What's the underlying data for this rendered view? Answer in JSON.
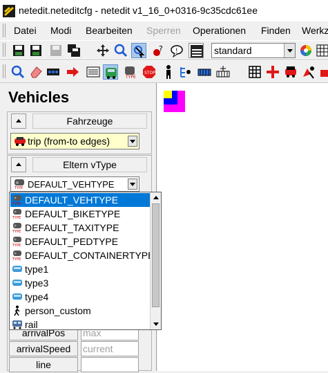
{
  "window": {
    "title": "netedit.neteditcfg - netedit v1_16_0+0316-9c35cdc61ee"
  },
  "menu": {
    "items": [
      {
        "label": "Datei",
        "disabled": false
      },
      {
        "label": "Modi",
        "disabled": false
      },
      {
        "label": "Bearbeiten",
        "disabled": false
      },
      {
        "label": "Sperren",
        "disabled": true
      },
      {
        "label": "Operationen",
        "disabled": false
      },
      {
        "label": "Finden",
        "disabled": false
      },
      {
        "label": "Werkz",
        "disabled": false
      }
    ]
  },
  "toolbar": {
    "mode_select_value": "standard"
  },
  "frame": {
    "title": "Vehicles",
    "vehicles_group": {
      "label": "Fahrzeuge",
      "selected_type": "trip (from-to edges)"
    },
    "parent_vtype_group": {
      "label": "Eltern vType",
      "selected_vtype": "DEFAULT_VEHTYPE"
    },
    "vtype_options": [
      {
        "label": "DEFAULT_VEHTYPE",
        "icon": "vtype-icon",
        "selected": true
      },
      {
        "label": "DEFAULT_BIKETYPE",
        "icon": "vtype-icon",
        "selected": false
      },
      {
        "label": "DEFAULT_TAXITYPE",
        "icon": "vtype-icon",
        "selected": false
      },
      {
        "label": "DEFAULT_PEDTYPE",
        "icon": "vtype-icon",
        "selected": false
      },
      {
        "label": "DEFAULT_CONTAINERTYPE",
        "icon": "vtype-icon",
        "selected": false
      },
      {
        "label": "type1",
        "icon": "car-blue-icon",
        "selected": false
      },
      {
        "label": "type3",
        "icon": "car-blue-icon",
        "selected": false
      },
      {
        "label": "type4",
        "icon": "car-blue-icon",
        "selected": false
      },
      {
        "label": "person_custom",
        "icon": "pedestrian-icon",
        "selected": false
      },
      {
        "label": "rail",
        "icon": "train-icon",
        "selected": false
      }
    ],
    "attributes": [
      {
        "label": "arrivalPos",
        "value": "max"
      },
      {
        "label": "arrivalSpeed",
        "value": "current"
      },
      {
        "label": "line",
        "value": ""
      }
    ]
  },
  "colors": {
    "selection": "#0078d7",
    "combo_highlight": "#ffffcc",
    "canvas_bg": "#ffffff"
  }
}
